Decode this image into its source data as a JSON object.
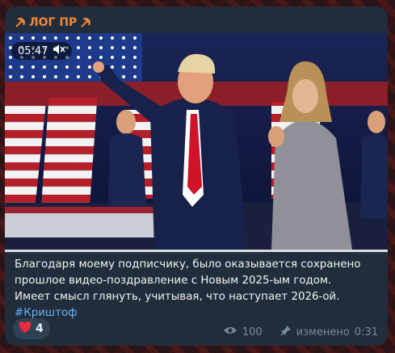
{
  "channel": {
    "name": "ЛОГ ПР"
  },
  "video": {
    "duration": "05:47",
    "muted_icon": "speaker-muted-icon",
    "progress": 1.0
  },
  "message": {
    "lines": [
      "Благодаря моему подписчику, было оказывается сохранено",
      "прошлое видео-поздравление с Новым 2025-ым годом.",
      "Имеет смысл глянуть, учитывая, что наступает 2026-ой."
    ],
    "hashtag": "#Криштоф"
  },
  "reaction": {
    "emoji": "heart-icon",
    "count": "4"
  },
  "meta": {
    "views": "100",
    "edited_label": "изменено",
    "time": "0:31"
  },
  "colors": {
    "accent": "#f0873a",
    "bubble": "#212d3b",
    "link": "#6ab3f3"
  }
}
